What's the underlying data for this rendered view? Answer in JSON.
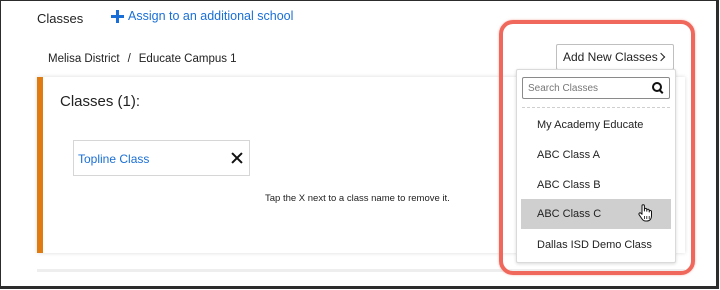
{
  "header": {
    "title": "Classes",
    "assign_link": "Assign to an additional school"
  },
  "breadcrumb": {
    "district": "Melisa District",
    "separator": "/",
    "campus": "Educate Campus 1"
  },
  "classes_card": {
    "title": "Classes (1):",
    "selected_classes": [
      "Topline Class"
    ],
    "hint": "Tap the X next to a class name to remove it."
  },
  "add_classes": {
    "button_label": "Add New Classes",
    "search_placeholder": "Search Classes",
    "options": [
      "My Academy Educate",
      "ABC Class A",
      "ABC Class B",
      "ABC Class C",
      "Dallas ISD Demo Class"
    ],
    "hovered_option": "ABC Class C"
  },
  "colors": {
    "accent_link": "#1a6fd6",
    "card_border": "#e07b12",
    "highlight_annotation": "#f0675b",
    "hover_background": "#cfcfcf"
  }
}
